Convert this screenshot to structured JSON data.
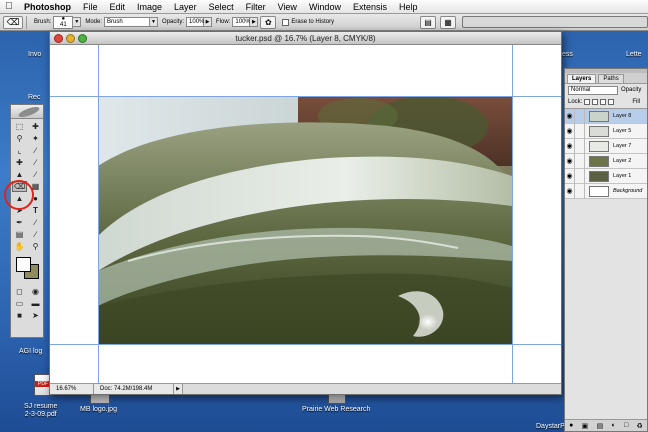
{
  "menubar": {
    "items": [
      "Photoshop",
      "File",
      "Edit",
      "Image",
      "Layer",
      "Select",
      "Filter",
      "View",
      "Window",
      "Extensis",
      "Help"
    ]
  },
  "options_bar": {
    "brush_label": "Brush:",
    "brush_size": "41",
    "mode_label": "Mode:",
    "mode_value": "Brush",
    "opacity_label": "Opacity:",
    "opacity_value": "100%",
    "flow_label": "Flow:",
    "flow_value": "100%",
    "erase_history_label": "Erase to History"
  },
  "desktop": {
    "icon_labels": {
      "top_left": "Invo",
      "top_left_2": "Rec",
      "top_right": "Lette",
      "top_right_2": "ess",
      "agi": "AGI log",
      "sj_resume": "SJ resume\n2-3-09.pdf",
      "mb_logo": "MB logo.jpg",
      "prairie": "Prairie Web Research",
      "daystar": "DaystarPassportDir"
    }
  },
  "document": {
    "title": "tucker.psd @ 16.7% (Layer 8, CMYK/8)",
    "zoom": "16.67%",
    "doc_size": "Doc: 74.2M/198.4M"
  },
  "layers_panel": {
    "tabs": [
      "Layers",
      "Paths"
    ],
    "blend_mode": "Normal",
    "opacity_label": "Opacity",
    "lock_label": "Lock:",
    "fill_label": "Fill",
    "layers": [
      {
        "name": "Layer 8",
        "selected": true,
        "thumb": "#c9d3c9"
      },
      {
        "name": "Layer 5",
        "selected": false,
        "thumb": "#d9ddd6"
      },
      {
        "name": "Layer 7",
        "selected": false,
        "thumb": "#e8eae6"
      },
      {
        "name": "Layer 2",
        "selected": false,
        "thumb": "#6c7448"
      },
      {
        "name": "Layer 1",
        "selected": false,
        "thumb": "#5c6143"
      },
      {
        "name": "Background",
        "selected": false,
        "thumb": "#ffffff"
      }
    ]
  },
  "colors": {
    "foreground": "#ffffff",
    "background": "#8f8b5c",
    "annotation_circle": "#e2221d",
    "guide": "#7fa4e6"
  }
}
